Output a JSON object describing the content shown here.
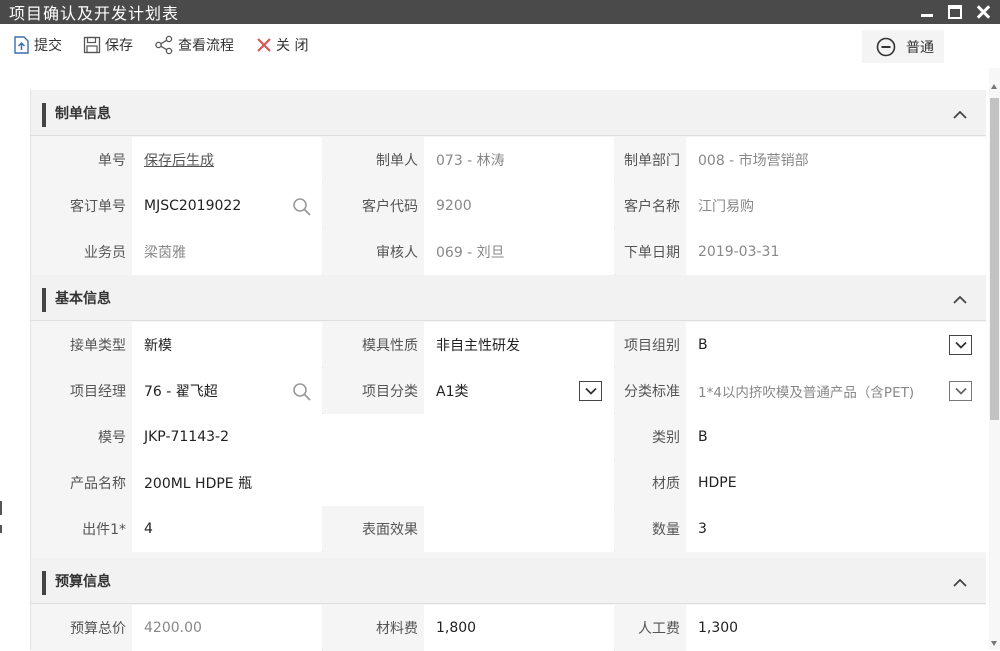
{
  "window": {
    "title": "项目确认及开发计划表"
  },
  "toolbar": {
    "submit": "提交",
    "save": "保存",
    "view_flow": "查看流程",
    "close": "关 闭",
    "mode": "普通"
  },
  "sections": {
    "order_info": {
      "title": "制单信息"
    },
    "basic_info": {
      "title": "基本信息"
    },
    "budget_info": {
      "title": "预算信息"
    }
  },
  "order_info": {
    "doc_no": {
      "label": "单号",
      "value": "保存后生成"
    },
    "creator": {
      "label": "制单人",
      "value": "073 - 林涛"
    },
    "dept": {
      "label": "制单部门",
      "value": "008 - 市场营销部"
    },
    "cust_order_no": {
      "label": "客订单号",
      "value": "MJSC2019022"
    },
    "cust_code": {
      "label": "客户代码",
      "value": "9200"
    },
    "cust_name": {
      "label": "客户名称",
      "value": "江门易购"
    },
    "salesman": {
      "label": "业务员",
      "value": "梁茵雅"
    },
    "reviewer": {
      "label": "审核人",
      "value": "069 - 刘旦"
    },
    "order_date": {
      "label": "下单日期",
      "value": "2019-03-31"
    }
  },
  "basic_info": {
    "order_type": {
      "label": "接单类型",
      "value": "新模"
    },
    "mold_nature": {
      "label": "模具性质",
      "value": "非自主性研发"
    },
    "project_group": {
      "label": "项目组别",
      "value": "B"
    },
    "project_manager": {
      "label": "项目经理",
      "value": "76 - 翟飞超"
    },
    "project_category": {
      "label": "项目分类",
      "value": "A1类"
    },
    "category_standard": {
      "label": "分类标准",
      "value": "1*4以内挤吹模及普通产品（含PET)"
    },
    "mold_no": {
      "label": "模号",
      "value": "JKP-71143-2"
    },
    "kind": {
      "label": "类别",
      "value": "B"
    },
    "product_name": {
      "label": "产品名称",
      "value": "200ML HDPE 瓶"
    },
    "material": {
      "label": "材质",
      "value": "HDPE"
    },
    "cavities": {
      "label": "出件1*",
      "value": "4"
    },
    "surface": {
      "label": "表面效果",
      "value": ""
    },
    "quantity": {
      "label": "数量",
      "value": "3"
    }
  },
  "budget_info": {
    "total": {
      "label": "预算总价",
      "value": "4200.00"
    },
    "material_cost": {
      "label": "材料费",
      "value": "1,800"
    },
    "labor_cost": {
      "label": "人工费",
      "value": "1,300"
    }
  },
  "icons": {
    "submit": "upload-doc-icon",
    "save": "floppy-icon",
    "flow": "share-nodes-icon",
    "close": "x-icon",
    "mode": "minus-circle-icon",
    "search": "magnifier-icon",
    "dropdown": "chevron-down-icon",
    "collapse": "chevron-up-icon"
  },
  "colors": {
    "titlebar": "#4a4a4a",
    "close_icon": "#d9534f",
    "section_bar": "#444444"
  }
}
